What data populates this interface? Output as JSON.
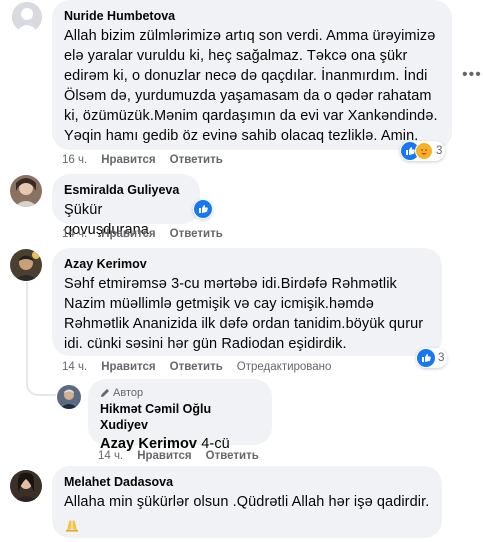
{
  "comments": [
    {
      "author": "Nuride Humbetova",
      "text": "Allah bizim zülmlərimizə artıq son verdi. Amma ürəyimizə\nelə yaralar vuruldu ki, heç sağalmaz. Təkcə ona şükr\nedirəm ki, o donuzlar necə də qaçdılar. İnanmırdım. İndi\nÖlsəm də, yurdumuzda yaşamasam da o qədər rahatam\nki, özümüzük.Mənim qardaşımın da evi var Xankəndində.\nYəqin hamı gedib öz evinə sahib olacaq tezliklə. Amin.",
      "time": "16 ч.",
      "like_label": "Нравится",
      "reply_label": "Ответить",
      "reaction_count": "3",
      "more_icon": "more-horizontal-icon"
    },
    {
      "author": "Esmiralda Guliyeva",
      "text": "Şükür qovuşdurana",
      "time": "14 ч.",
      "like_label": "Нравится",
      "reply_label": "Ответить"
    },
    {
      "author": "Azay Kerimov",
      "text": "Səhf etmirəmsə 3-cu mərtəbə idi.Birdəfə Rəhmətlik\nNazim müəllimlə getmişik və cay icmişik.həmdə\nRəhmətlik Ananizida ilk dəfə ordan tanidim.böyük qurur\nidi. cünki səsini hər gün Radiodan eşidirdik.",
      "time": "14 ч.",
      "like_label": "Нравится",
      "reply_label": "Ответить",
      "edited_label": "Отредактировано",
      "reaction_count": "3"
    },
    {
      "author_badge": "Автор",
      "author": "Hikmət Cəmil Oğlu Xudiyev",
      "mention": "Azay Kerimov",
      "text": " 4-cü",
      "time": "14 ч.",
      "like_label": "Нравится",
      "reply_label": "Ответить"
    },
    {
      "author": "Melahet Dadasova",
      "text": "Allaha min şükürlər olsun .Qüdrətli Allah hər işə qadirdir.",
      "emoji": "praying-hands"
    }
  ],
  "colors": {
    "bubble": "#f0f2f5",
    "meta": "#65676b",
    "like_blue": "#1877f2",
    "care_yellow": "#f7b125"
  }
}
